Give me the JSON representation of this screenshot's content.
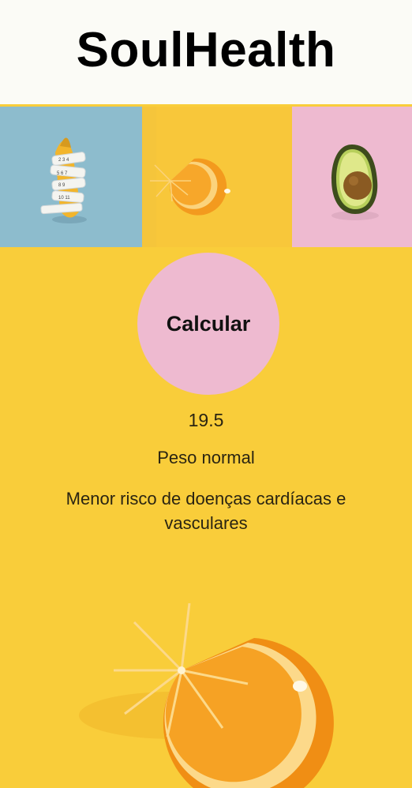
{
  "app": {
    "title": "SoulHealth"
  },
  "images": [
    {
      "name": "measuring-tape-corn-photo",
      "icon": "corn-icon",
      "background": "#8dbccd"
    },
    {
      "name": "orange-slice-photo",
      "icon": "orange-slice-icon",
      "background": "#f8c73a"
    },
    {
      "name": "avocado-photo",
      "icon": "avocado-icon",
      "background": "#eebad0"
    }
  ],
  "calculator": {
    "button_label": "Calcular",
    "result_value": "19.5",
    "result_category": "Peso normal",
    "result_description": "Menor risco de doenças cardíacas e vasculares"
  },
  "colors": {
    "background": "#f9cd3a",
    "header": "#fbfbf6",
    "button": "#eebad0",
    "accent_blue": "#8dbccd"
  }
}
